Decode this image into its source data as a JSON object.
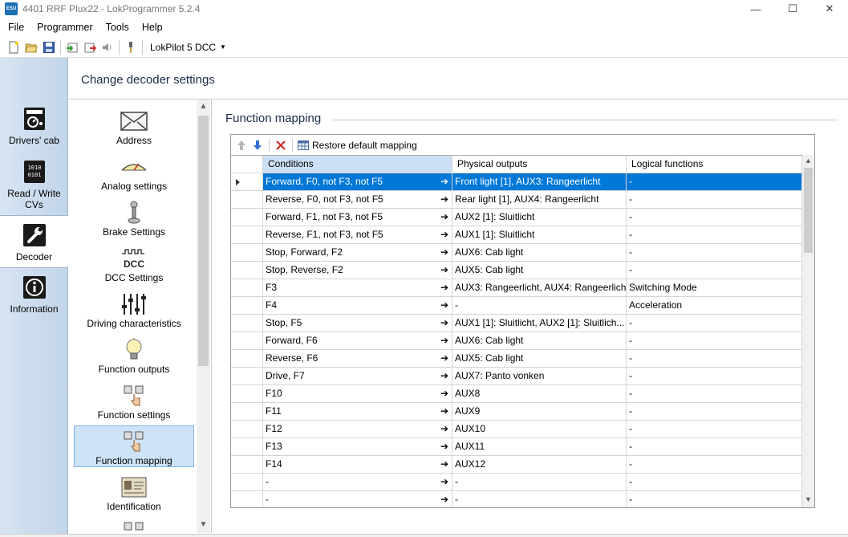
{
  "window": {
    "title": "4401 RRF Plux22 - LokProgrammer 5.2.4",
    "app_icon_text": "ESU",
    "controls": [
      "—",
      "☐",
      "✕"
    ]
  },
  "menu": [
    "File",
    "Programmer",
    "Tools",
    "Help"
  ],
  "toolbar": {
    "buttons": [
      "new-file-icon",
      "open-folder-icon",
      "save-icon",
      "read-decoder-icon",
      "write-decoder-icon",
      "sound-icon",
      "programmer-icon"
    ],
    "decoder_type": "LokPilot 5 DCC"
  },
  "nav": {
    "items": [
      {
        "label": "Drivers' cab",
        "icon": "drivers-cab-icon"
      },
      {
        "label": "Read / Write CVs",
        "icon": "read-write-cvs-icon"
      },
      {
        "label": "Decoder",
        "icon": "decoder-wrench-icon",
        "selected": true
      },
      {
        "label": "Information",
        "icon": "information-icon"
      }
    ]
  },
  "header": {
    "title": "Change decoder settings"
  },
  "settings": {
    "items": [
      {
        "label": "Address",
        "icon": "envelope-icon"
      },
      {
        "label": "Analog settings",
        "icon": "analog-meter-icon"
      },
      {
        "label": "Brake Settings",
        "icon": "brake-lever-icon"
      },
      {
        "label": "DCC Settings",
        "icon": "dcc-icon",
        "icon_text": "DCC"
      },
      {
        "label": "Driving characteristics",
        "icon": "sliders-icon"
      },
      {
        "label": "Function outputs",
        "icon": "light-bulb-icon"
      },
      {
        "label": "Function settings",
        "icon": "function-keys-icon"
      },
      {
        "label": "Function mapping",
        "icon": "function-keys-icon",
        "selected": true
      },
      {
        "label": "Identification",
        "icon": "id-card-icon"
      }
    ]
  },
  "function_mapping": {
    "group_title": "Function mapping",
    "toolbar": {
      "move_up": "arrow-up-icon",
      "move_down": "arrow-down-icon",
      "delete": "delete-x-icon",
      "restore_label": "Restore default mapping"
    },
    "columns": [
      "Conditions",
      "Physical outputs",
      "Logical functions"
    ],
    "rows": [
      {
        "conditions": "Forward, F0, not F3, not F5",
        "physical": "Front light [1], AUX3: Rangeerlicht",
        "logical": "-",
        "selected": true
      },
      {
        "conditions": "Reverse, F0, not F3, not F5",
        "physical": "Rear light [1], AUX4: Rangeerlicht",
        "logical": "-"
      },
      {
        "conditions": "Forward, F1, not F3, not F5",
        "physical": "AUX2 [1]: Sluitlicht",
        "logical": "-"
      },
      {
        "conditions": "Reverse, F1, not F3, not F5",
        "physical": "AUX1 [1]: Sluitlicht",
        "logical": "-"
      },
      {
        "conditions": "Stop, Forward, F2",
        "physical": "AUX6: Cab light",
        "logical": "-"
      },
      {
        "conditions": "Stop, Reverse, F2",
        "physical": "AUX5: Cab light",
        "logical": "-"
      },
      {
        "conditions": "F3",
        "physical": "AUX3: Rangeerlicht, AUX4: Rangeerlicht",
        "logical": "Switching Mode"
      },
      {
        "conditions": "F4",
        "physical": "-",
        "logical": "Acceleration"
      },
      {
        "conditions": "Stop, F5",
        "physical": "AUX1 [1]: Sluitlicht, AUX2 [1]: Sluitlich...",
        "logical": "-"
      },
      {
        "conditions": "Forward, F6",
        "physical": "AUX6: Cab light",
        "logical": "-"
      },
      {
        "conditions": "Reverse, F6",
        "physical": "AUX5: Cab light",
        "logical": "-"
      },
      {
        "conditions": "Drive, F7",
        "physical": "AUX7: Panto vonken",
        "logical": "-"
      },
      {
        "conditions": "F10",
        "physical": "AUX8",
        "logical": "-"
      },
      {
        "conditions": "F11",
        "physical": "AUX9",
        "logical": "-"
      },
      {
        "conditions": "F12",
        "physical": "AUX10",
        "logical": "-"
      },
      {
        "conditions": "F13",
        "physical": "AUX11",
        "logical": "-"
      },
      {
        "conditions": "F14",
        "physical": "AUX12",
        "logical": "-"
      },
      {
        "conditions": "-",
        "physical": "-",
        "logical": "-"
      },
      {
        "conditions": "-",
        "physical": "-",
        "logical": "-"
      }
    ]
  },
  "colors": {
    "selection": "#0078d7",
    "selected_nav_bg": "#cde3f7",
    "column_header_active": "#cce0f5"
  }
}
